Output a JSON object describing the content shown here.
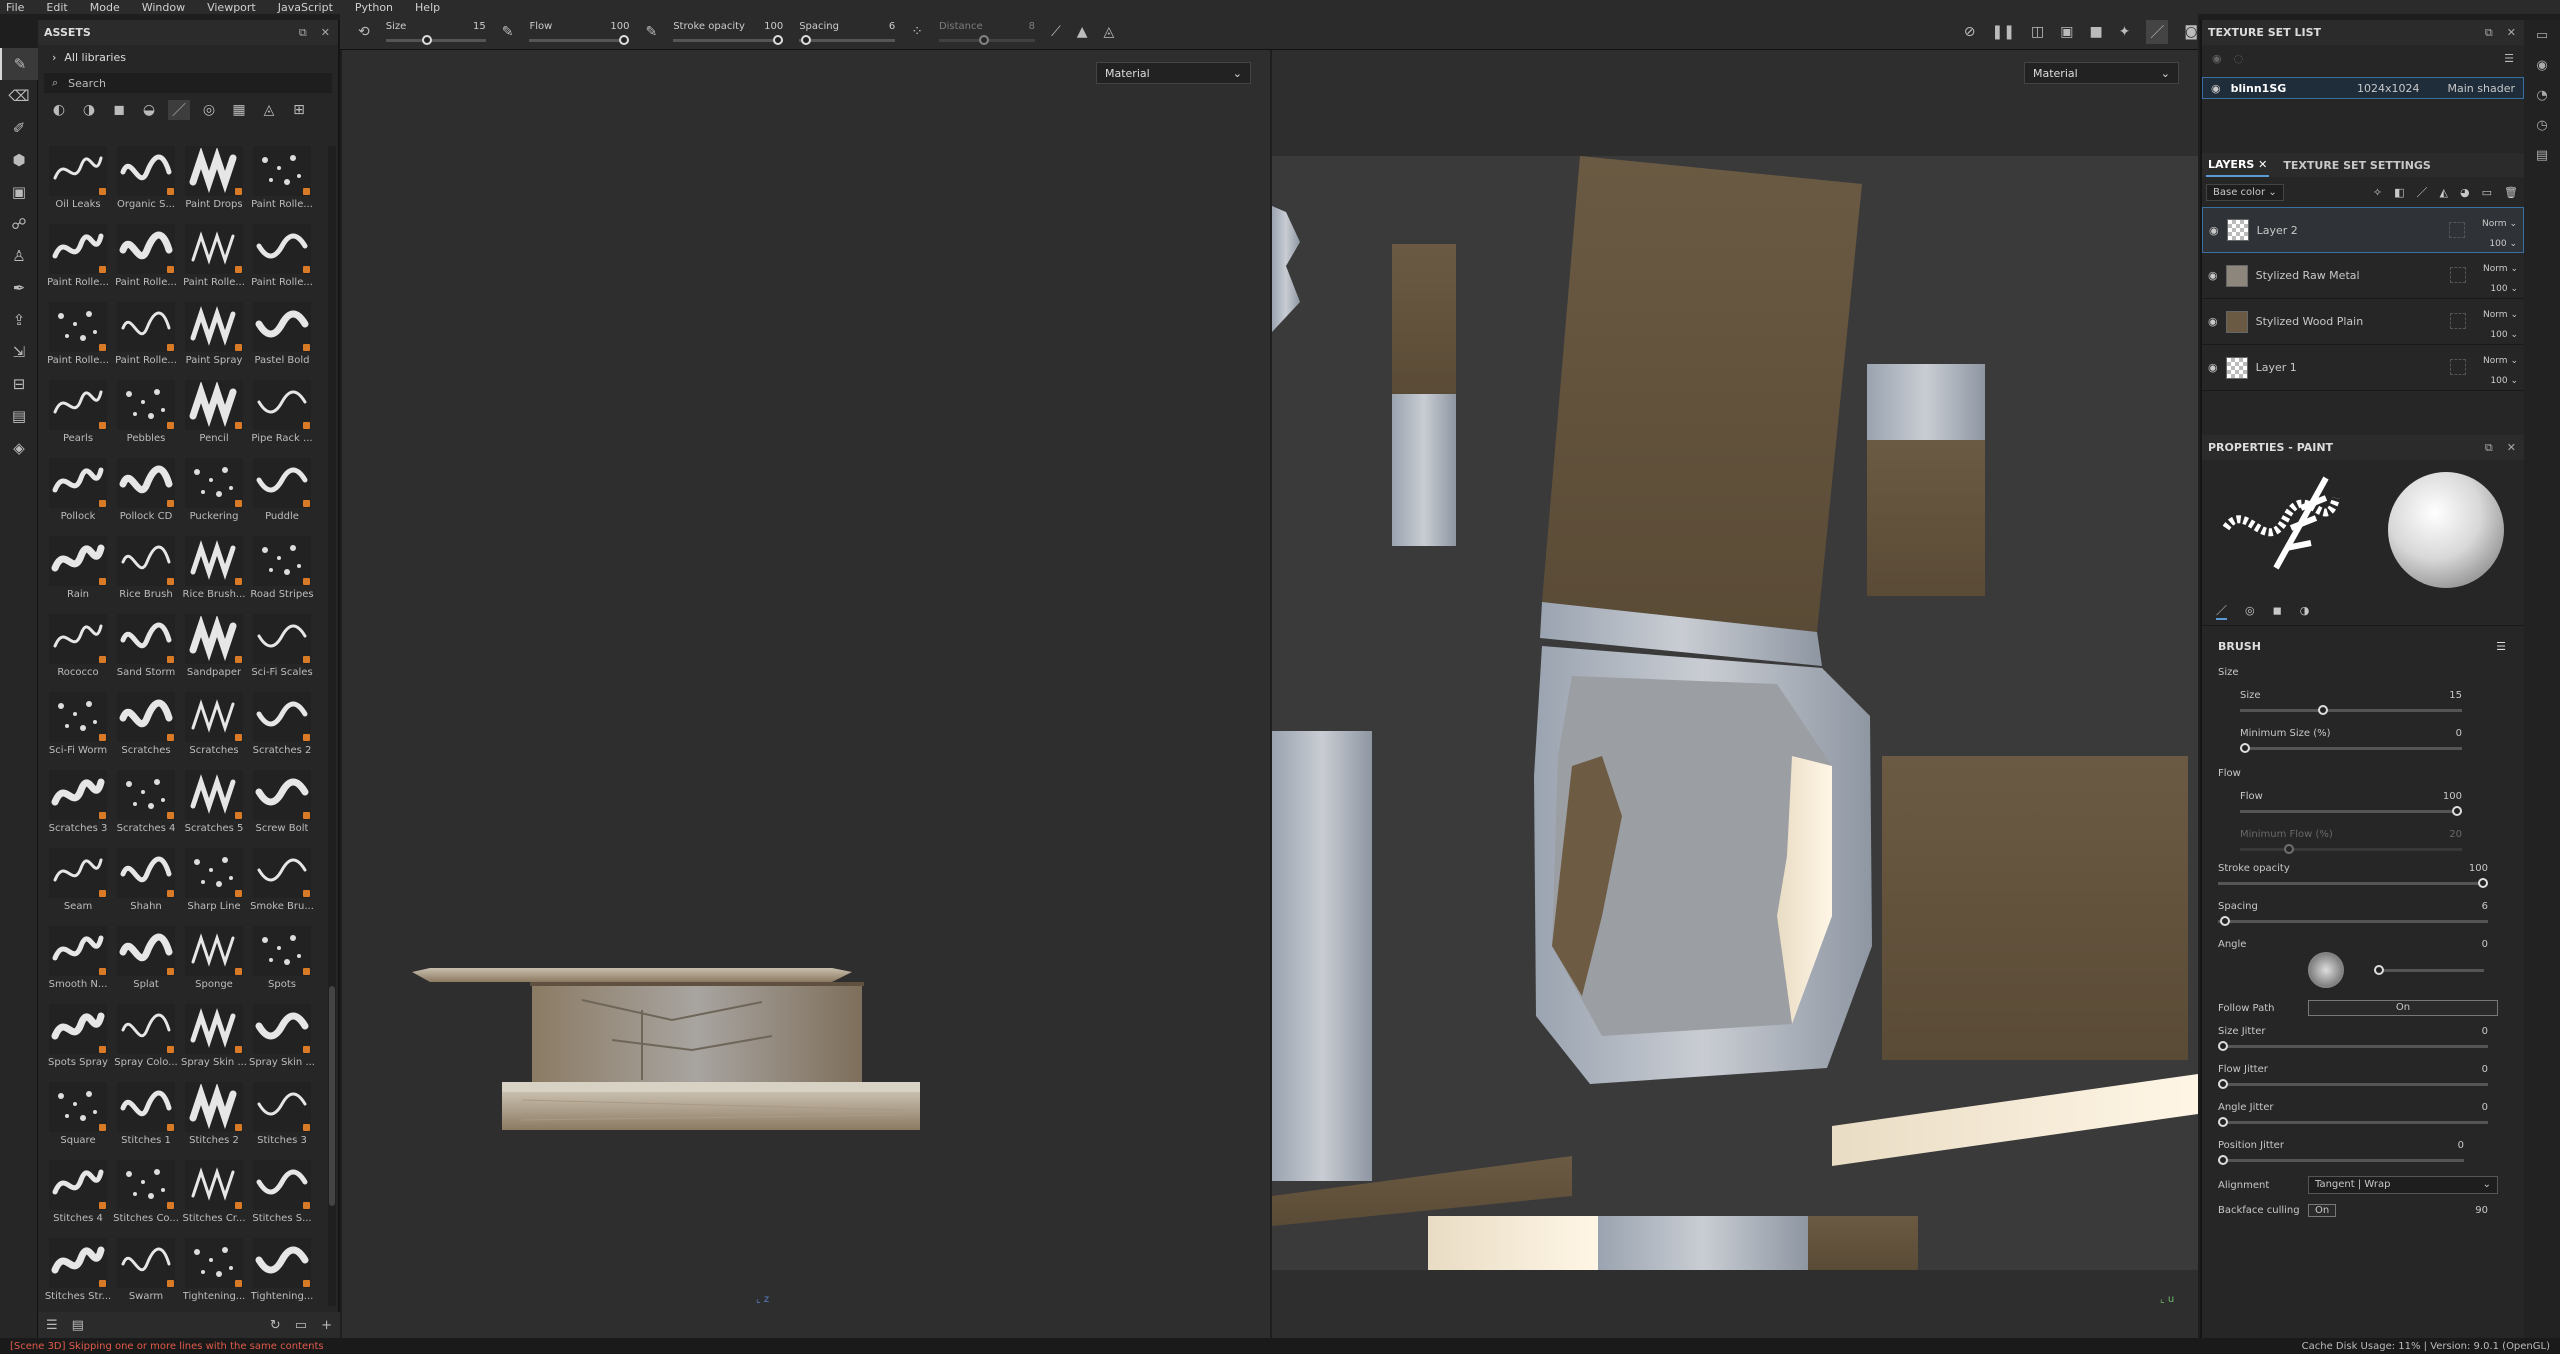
{
  "menu": [
    "File",
    "Edit",
    "Mode",
    "Window",
    "Viewport",
    "JavaScript",
    "Python",
    "Help"
  ],
  "assets": {
    "title": "ASSETS",
    "library": "All libraries",
    "search_placeholder": "Search",
    "items": [
      "Oil Leaks",
      "Organic S...",
      "Paint Drops",
      "Paint Rolle...",
      "Paint Rolle...",
      "Paint Rolle...",
      "Paint Rolle...",
      "Paint Rolle...",
      "Paint Rolle...",
      "Paint Rolle...",
      "Paint Spray",
      "Pastel Bold",
      "Pearls",
      "Pebbles",
      "Pencil",
      "Pipe Rack ...",
      "Pollock",
      "Pollock CD",
      "Puckering",
      "Puddle",
      "Rain",
      "Rice Brush",
      "Rice Brush...",
      "Road Stripes",
      "Rococco",
      "Sand Storm",
      "Sandpaper",
      "Sci-Fi Scales",
      "Sci-Fi Worm",
      "Scratches",
      "Scratches",
      "Scratches 2",
      "Scratches 3",
      "Scratches 4",
      "Scratches 5",
      "Screw Bolt",
      "Seam",
      "Shahn",
      "Sharp Line",
      "Smoke Bru...",
      "Smooth N...",
      "Splat",
      "Sponge",
      "Spots",
      "Spots Spray",
      "Spray Colo...",
      "Spray Skin ...",
      "Spray Skin ...",
      "Square",
      "Stitches 1",
      "Stitches 2",
      "Stitches 3",
      "Stitches 4",
      "Stitches Co...",
      "Stitches Cr...",
      "Stitches S...",
      "Stitches Str...",
      "Swarm",
      "Tightening...",
      "Tightening...",
      "",
      "",
      "",
      ""
    ]
  },
  "toolbar": {
    "size_label": "Size",
    "size_value": "15",
    "flow_label": "Flow",
    "flow_value": "100",
    "stroke_label": "Stroke opacity",
    "stroke_value": "100",
    "spacing_label": "Spacing",
    "spacing_value": "6",
    "distance_label": "Distance",
    "distance_value": "8"
  },
  "viewports": {
    "left_mode": "Material",
    "right_mode": "Material"
  },
  "texture_set": {
    "title": "TEXTURE SET LIST",
    "name": "blinn1SG",
    "resolution": "1024x1024",
    "shader": "Main shader"
  },
  "layers": {
    "tab_layers": "LAYERS",
    "tab_settings": "TEXTURE SET SETTINGS",
    "channel": "Base color",
    "items": [
      {
        "name": "Layer 2",
        "blend": "Norm",
        "opacity": "100"
      },
      {
        "name": "Stylized Raw Metal",
        "blend": "Norm",
        "opacity": "100"
      },
      {
        "name": "Stylized Wood Plain",
        "blend": "Norm",
        "opacity": "100"
      },
      {
        "name": "Layer 1",
        "blend": "Norm",
        "opacity": "100"
      }
    ]
  },
  "properties": {
    "title": "PROPERTIES - PAINT",
    "brush_header": "BRUSH",
    "size_group": "Size",
    "size_label": "Size",
    "size_value": "15",
    "minsize_label": "Minimum Size (%)",
    "minsize_value": "0",
    "flow_group": "Flow",
    "flow_label": "Flow",
    "flow_value": "100",
    "minflow_label": "Minimum Flow (%)",
    "minflow_value": "20",
    "stroke_label": "Stroke opacity",
    "stroke_value": "100",
    "spacing_label": "Spacing",
    "spacing_value": "6",
    "angle_label": "Angle",
    "angle_value": "0",
    "follow_label": "Follow Path",
    "follow_value": "On",
    "sizejit_label": "Size Jitter",
    "sizejit_value": "0",
    "flowjit_label": "Flow Jitter",
    "flowjit_value": "0",
    "anglejit_label": "Angle Jitter",
    "anglejit_value": "0",
    "posjit_label": "Position Jitter",
    "posjit_value": "0",
    "align_label": "Alignment",
    "align_value": "Tangent | Wrap",
    "backface_label": "Backface culling",
    "backface_value": "On",
    "backface_num": "90"
  },
  "status": {
    "message": "[Scene 3D] Skipping one or more lines with the same contents",
    "right": "Cache Disk Usage:   11% | Version: 9.0.1 (OpenGL)"
  }
}
